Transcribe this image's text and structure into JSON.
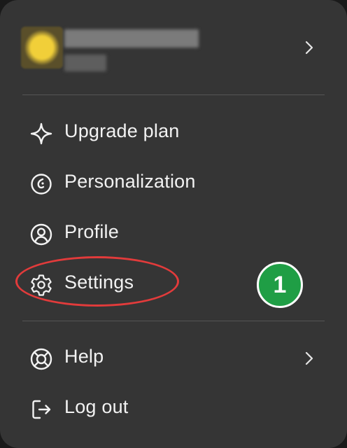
{
  "account": {
    "name": "",
    "subtitle": ""
  },
  "menu": {
    "items": [
      {
        "label": "Upgrade plan",
        "icon": "sparkle-icon"
      },
      {
        "label": "Personalization",
        "icon": "personalization-icon"
      },
      {
        "label": "Profile",
        "icon": "user-circle-icon"
      },
      {
        "label": "Settings",
        "icon": "gear-icon"
      },
      {
        "label": "Help",
        "icon": "lifebuoy-icon"
      },
      {
        "label": "Log out",
        "icon": "logout-icon"
      }
    ]
  },
  "annotation": {
    "step_number": "1",
    "highlight_color": "#e23b3b",
    "badge_color": "#1f9e45"
  },
  "colors": {
    "menu_background": "#353535",
    "text": "#f2f2f2",
    "divider": "#555555"
  }
}
